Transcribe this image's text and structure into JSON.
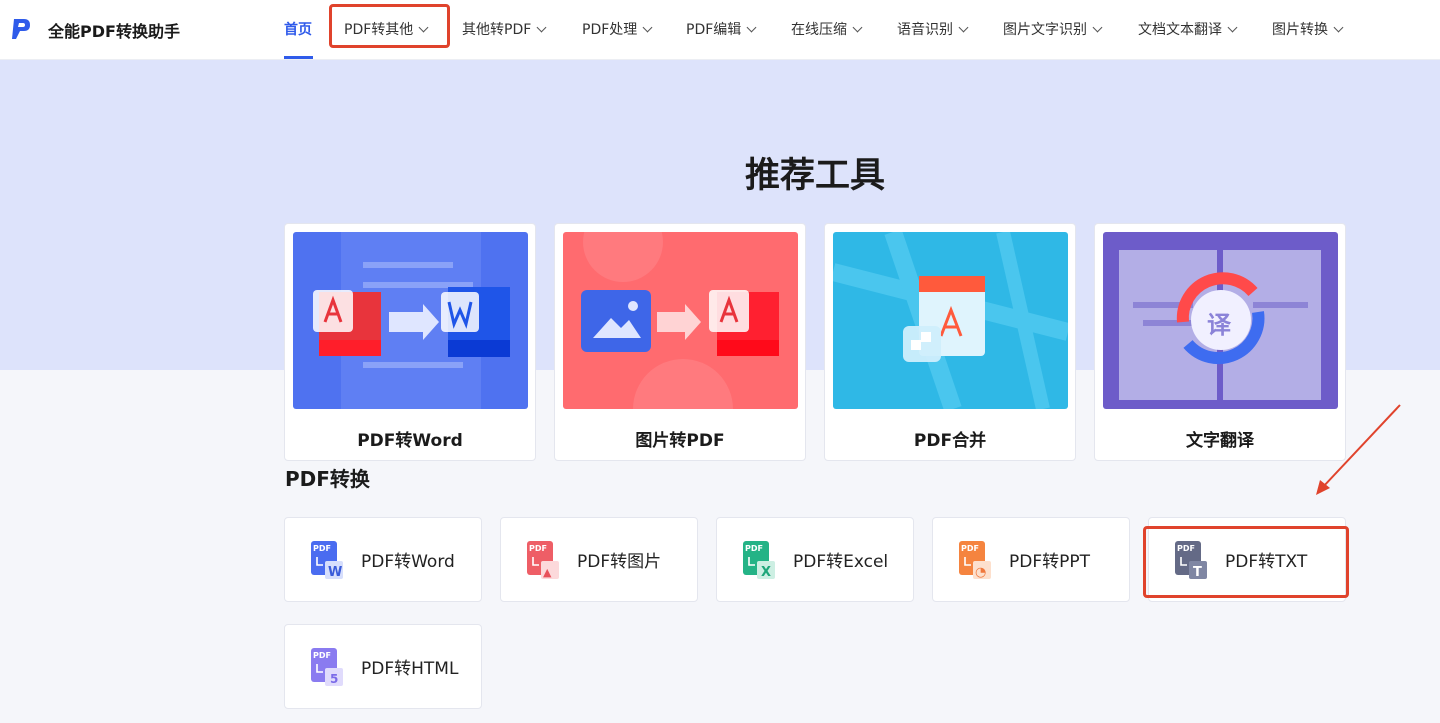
{
  "header": {
    "brand": "全能PDF转换助手",
    "nav": [
      {
        "label": "首页",
        "dropdown": false,
        "active": true
      },
      {
        "label": "PDF转其他",
        "dropdown": true,
        "active": false
      },
      {
        "label": "其他转PDF",
        "dropdown": true,
        "active": false
      },
      {
        "label": "PDF处理",
        "dropdown": true,
        "active": false
      },
      {
        "label": "PDF编辑",
        "dropdown": true,
        "active": false
      },
      {
        "label": "在线压缩",
        "dropdown": true,
        "active": false
      },
      {
        "label": "语音识别",
        "dropdown": true,
        "active": false
      },
      {
        "label": "图片文字识别",
        "dropdown": true,
        "active": false
      },
      {
        "label": "文档文本翻译",
        "dropdown": true,
        "active": false
      },
      {
        "label": "图片转换",
        "dropdown": true,
        "active": false
      }
    ]
  },
  "recommend": {
    "title": "推荐工具",
    "cards": [
      {
        "label": "PDF转Word",
        "icon": "pdf-to-word-illustration"
      },
      {
        "label": "图片转PDF",
        "icon": "image-to-pdf-illustration"
      },
      {
        "label": "PDF合并",
        "icon": "pdf-merge-illustration"
      },
      {
        "label": "文字翻译",
        "icon": "text-translate-illustration",
        "glyph": "译"
      }
    ]
  },
  "conversion": {
    "title": "PDF转换",
    "tools": [
      {
        "label": "PDF转Word",
        "icon": "pdf-word-icon",
        "badge": "W",
        "color": "#3a5bd9"
      },
      {
        "label": "PDF转图片",
        "icon": "pdf-image-icon",
        "badge": "▲",
        "color": "#e8515b"
      },
      {
        "label": "PDF转Excel",
        "icon": "pdf-excel-icon",
        "badge": "X",
        "color": "#1fa67a"
      },
      {
        "label": "PDF转PPT",
        "icon": "pdf-ppt-icon",
        "badge": "◔",
        "color": "#f0783c"
      },
      {
        "label": "PDF转TXT",
        "icon": "pdf-txt-icon",
        "badge": "T",
        "color": "#5a5f7a"
      },
      {
        "label": "PDF转HTML",
        "icon": "pdf-html-icon",
        "badge": "5",
        "color": "#7b6be8"
      }
    ],
    "pdf_tag": "PDF"
  },
  "colors": {
    "accent": "#2f5bea",
    "annotation": "#e0432c"
  }
}
